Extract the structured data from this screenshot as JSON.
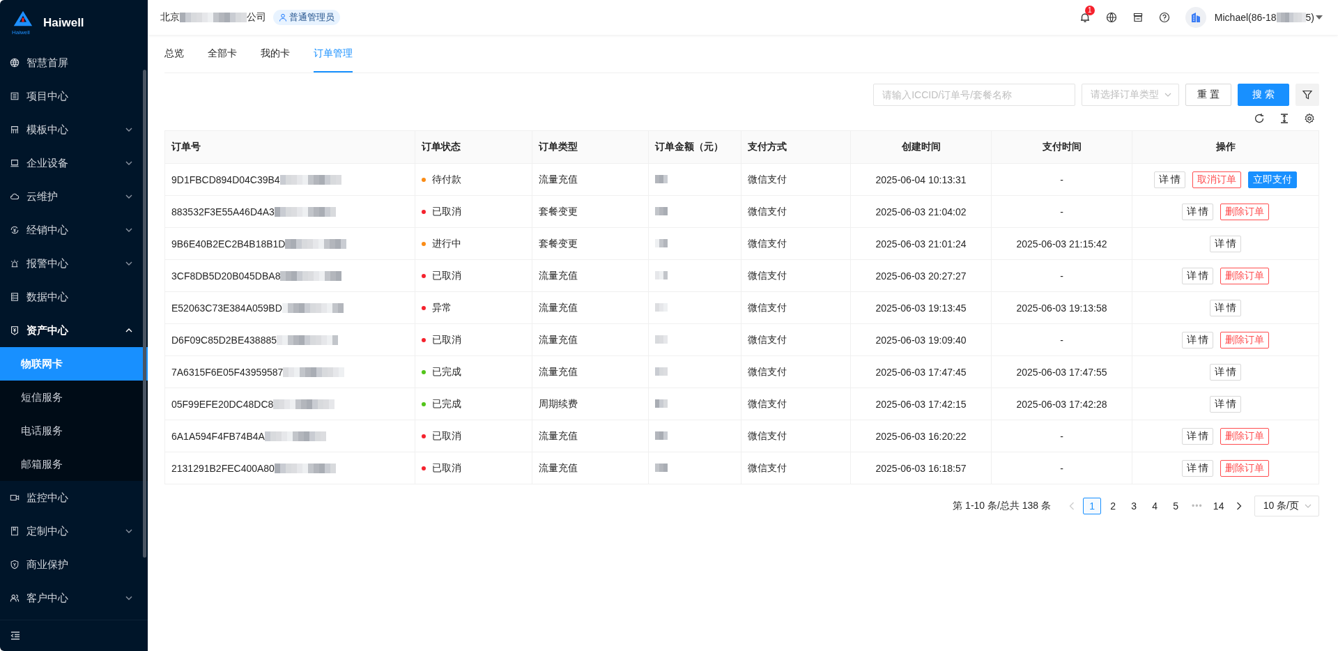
{
  "sidebar": {
    "brand": "Haiwell",
    "logo_caption": "Haiwell",
    "items": [
      {
        "label": "智慧首屏"
      },
      {
        "label": "项目中心"
      },
      {
        "label": "模板中心",
        "expanded": false
      },
      {
        "label": "企业设备",
        "expanded": false
      },
      {
        "label": "云维护",
        "expanded": false
      },
      {
        "label": "经销中心",
        "expanded": false
      },
      {
        "label": "报警中心",
        "expanded": false
      },
      {
        "label": "数据中心"
      },
      {
        "label": "资产中心",
        "expanded": true,
        "children": [
          {
            "label": "物联网卡",
            "selected": true
          },
          {
            "label": "短信服务",
            "selected": false
          },
          {
            "label": "电话服务",
            "selected": false
          },
          {
            "label": "邮箱服务",
            "selected": false
          }
        ]
      },
      {
        "label": "监控中心"
      },
      {
        "label": "定制中心",
        "expanded": false
      },
      {
        "label": "商业保护"
      },
      {
        "label": "客户中心",
        "expanded": false
      }
    ]
  },
  "header": {
    "company_prefix": "北京",
    "company_suffix": "公司",
    "role_badge": "普通管理员",
    "notification_count": "1",
    "user_prefix": "Michael(86-18",
    "user_suffix": "5)"
  },
  "tabs": [
    {
      "label": "总览",
      "selected": false
    },
    {
      "label": "全部卡",
      "selected": false
    },
    {
      "label": "我的卡",
      "selected": false
    },
    {
      "label": "订单管理",
      "selected": true
    }
  ],
  "filters": {
    "search_placeholder": "请输入ICCID/订单号/套餐名称",
    "type_placeholder": "请选择订单类型",
    "reset": "重 置",
    "search": "搜 索"
  },
  "table": {
    "columns": [
      "订单号",
      "订单状态",
      "订单类型",
      "订单金额（元）",
      "支付方式",
      "创建时间",
      "支付时间",
      "操作"
    ],
    "rows": [
      {
        "order_no": "9D1FBCD894D04C39B4",
        "status": "待付款",
        "color": "#fa8c16",
        "type": "流量充值",
        "payment": "微信支付",
        "created": "2025-06-04 10:13:31",
        "paid": "-",
        "actions": [
          {
            "label": "详 情",
            "kind": "default"
          },
          {
            "label": "取消订单",
            "kind": "danger"
          },
          {
            "label": "立即支付",
            "kind": "primary"
          }
        ]
      },
      {
        "order_no": "883532F3E55A46D4A3",
        "status": "已取消",
        "color": "#f5222d",
        "type": "套餐变更",
        "payment": "微信支付",
        "created": "2025-06-03 21:04:02",
        "paid": "-",
        "actions": [
          {
            "label": "详 情",
            "kind": "default"
          },
          {
            "label": "删除订单",
            "kind": "danger"
          }
        ]
      },
      {
        "order_no": "9B6E40B2EC2B4B18B1D",
        "status": "进行中",
        "color": "#fa8c16",
        "type": "套餐变更",
        "payment": "微信支付",
        "created": "2025-06-03 21:01:24",
        "paid": "2025-06-03 21:15:42",
        "actions": [
          {
            "label": "详 情",
            "kind": "default"
          }
        ]
      },
      {
        "order_no": "3CF8DB5D20B045DBA8",
        "status": "已取消",
        "color": "#f5222d",
        "type": "流量充值",
        "payment": "微信支付",
        "created": "2025-06-03 20:27:27",
        "paid": "-",
        "actions": [
          {
            "label": "详 情",
            "kind": "default"
          },
          {
            "label": "删除订单",
            "kind": "danger"
          }
        ]
      },
      {
        "order_no": "E52063C73E384A059BD",
        "status": "异常",
        "color": "#f5222d",
        "type": "流量充值",
        "payment": "微信支付",
        "created": "2025-06-03 19:13:45",
        "paid": "2025-06-03 19:13:58",
        "actions": [
          {
            "label": "详 情",
            "kind": "default"
          }
        ]
      },
      {
        "order_no": "D6F09C85D2BE438885",
        "status": "已取消",
        "color": "#f5222d",
        "type": "流量充值",
        "payment": "微信支付",
        "created": "2025-06-03 19:09:40",
        "paid": "-",
        "actions": [
          {
            "label": "详 情",
            "kind": "default"
          },
          {
            "label": "删除订单",
            "kind": "danger"
          }
        ]
      },
      {
        "order_no": "7A6315F6E05F43959587",
        "status": "已完成",
        "color": "#52c41a",
        "type": "流量充值",
        "payment": "微信支付",
        "created": "2025-06-03 17:47:45",
        "paid": "2025-06-03 17:47:55",
        "actions": [
          {
            "label": "详 情",
            "kind": "default"
          }
        ]
      },
      {
        "order_no": "05F99EFE20DC48DC8",
        "status": "已完成",
        "color": "#52c41a",
        "type": "周期续费",
        "payment": "微信支付",
        "created": "2025-06-03 17:42:15",
        "paid": "2025-06-03 17:42:28",
        "actions": [
          {
            "label": "详 情",
            "kind": "default"
          }
        ]
      },
      {
        "order_no": "6A1A594F4FB74B4A",
        "status": "已取消",
        "color": "#f5222d",
        "type": "流量充值",
        "payment": "微信支付",
        "created": "2025-06-03 16:20:22",
        "paid": "-",
        "actions": [
          {
            "label": "详 情",
            "kind": "default"
          },
          {
            "label": "删除订单",
            "kind": "danger"
          }
        ]
      },
      {
        "order_no": "2131291B2FEC400A80",
        "status": "已取消",
        "color": "#f5222d",
        "type": "流量充值",
        "payment": "微信支付",
        "created": "2025-06-03 16:18:57",
        "paid": "-",
        "actions": [
          {
            "label": "详 情",
            "kind": "default"
          },
          {
            "label": "删除订单",
            "kind": "danger"
          }
        ]
      }
    ]
  },
  "pagination": {
    "summary": "第 1-10 条/总共 138 条",
    "prev_disabled": true,
    "next_disabled": false,
    "pages": [
      {
        "kind": "page",
        "label": "1",
        "selected": true
      },
      {
        "kind": "page",
        "label": "2",
        "selected": false
      },
      {
        "kind": "page",
        "label": "3",
        "selected": false
      },
      {
        "kind": "page",
        "label": "4",
        "selected": false
      },
      {
        "kind": "page",
        "label": "5",
        "selected": false
      },
      {
        "kind": "ellipsis",
        "label": "•••"
      },
      {
        "kind": "page",
        "label": "14",
        "selected": false
      }
    ],
    "page_size": "10 条/页"
  }
}
